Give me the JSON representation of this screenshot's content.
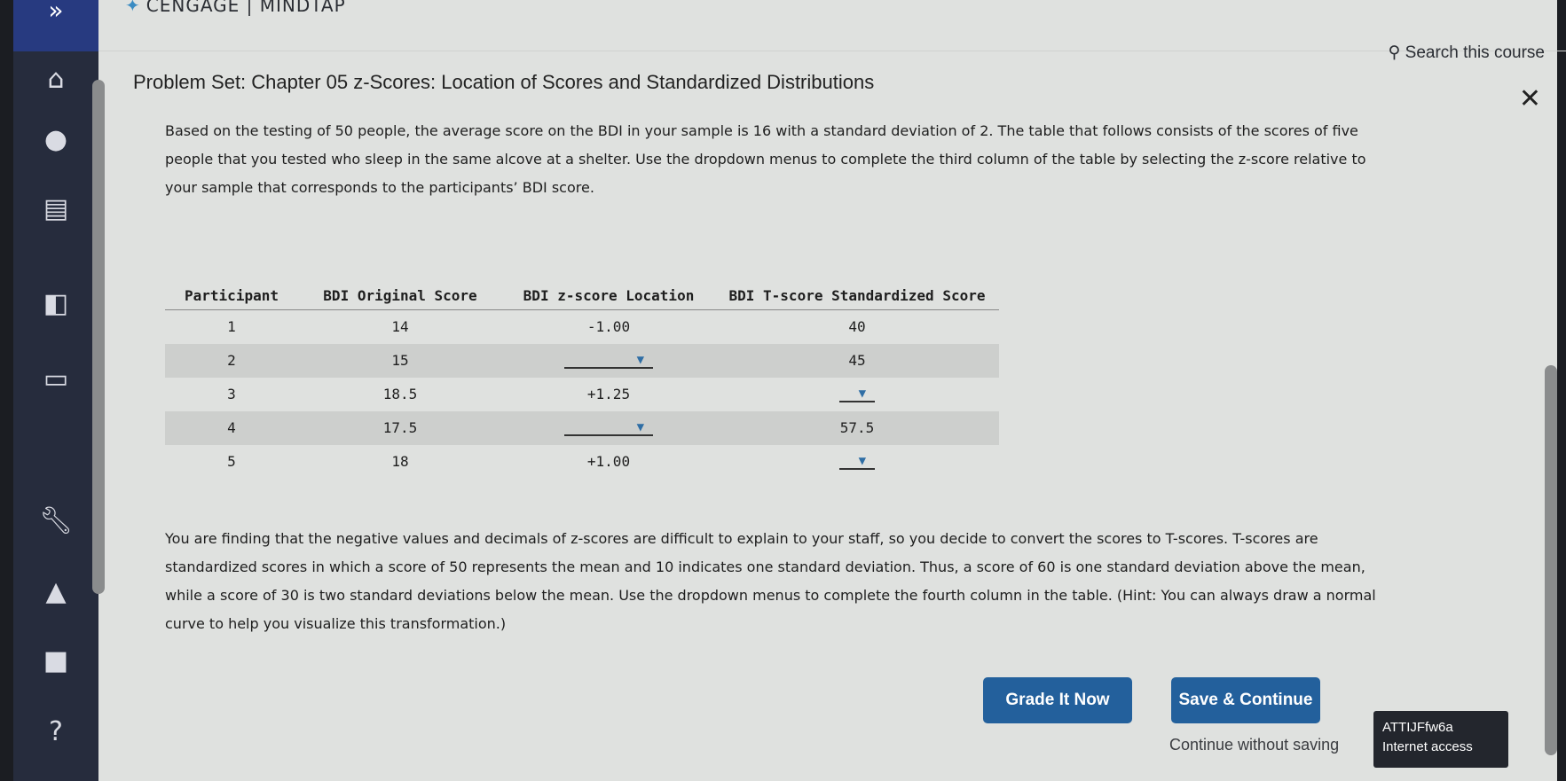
{
  "app": {
    "brand": "CENGAGE | MINDTAP",
    "search_label": "Search this course"
  },
  "page_title": "Problem Set: Chapter 05 z-Scores: Location of Scores and Standardized Distributions",
  "intro": "Based on the testing of 50 people, the average score on the BDI in your sample is 16 with a standard deviation of 2. The table that follows consists of the scores of five people that you tested who sleep in the same alcove at a shelter. Use the dropdown menus to complete the third column of the table by selecting the z-score relative to your sample that corresponds to the participants’ BDI score.",
  "table": {
    "headers": [
      "Participant",
      "BDI Original Score",
      "BDI z-score Location",
      "BDI T-score Standardized Score"
    ],
    "rows": [
      {
        "participant": "1",
        "original": "14",
        "z": "-1.00",
        "t": "40"
      },
      {
        "participant": "2",
        "original": "15",
        "z": "",
        "t": "45"
      },
      {
        "participant": "3",
        "original": "18.5",
        "z": "+1.25",
        "t": ""
      },
      {
        "participant": "4",
        "original": "17.5",
        "z": "",
        "t": "57.5"
      },
      {
        "participant": "5",
        "original": "18",
        "z": "+1.00",
        "t": ""
      }
    ]
  },
  "followup": "You are finding that the negative values and decimals of z-scores are difficult to explain to your staff, so you decide to convert the scores to T-scores. T-scores are standardized scores in which a score of 50 represents the mean and 10 indicates one standard deviation. Thus, a score of 60 is one standard deviation above the mean, while a score of 30 is two standard deviations below the mean. Use the dropdown menus to complete the fourth column in the table. (Hint: You can always draw a normal curve to help you visualize this transformation.)",
  "buttons": {
    "grade": "Grade It Now",
    "save": "Save & Continue",
    "continue": "Continue without saving"
  },
  "tooltip": {
    "line1": "ATTIJFfw6a",
    "line2": "Internet access"
  },
  "colors": {
    "accent": "#23609c",
    "sidebar": "#262c3d"
  }
}
